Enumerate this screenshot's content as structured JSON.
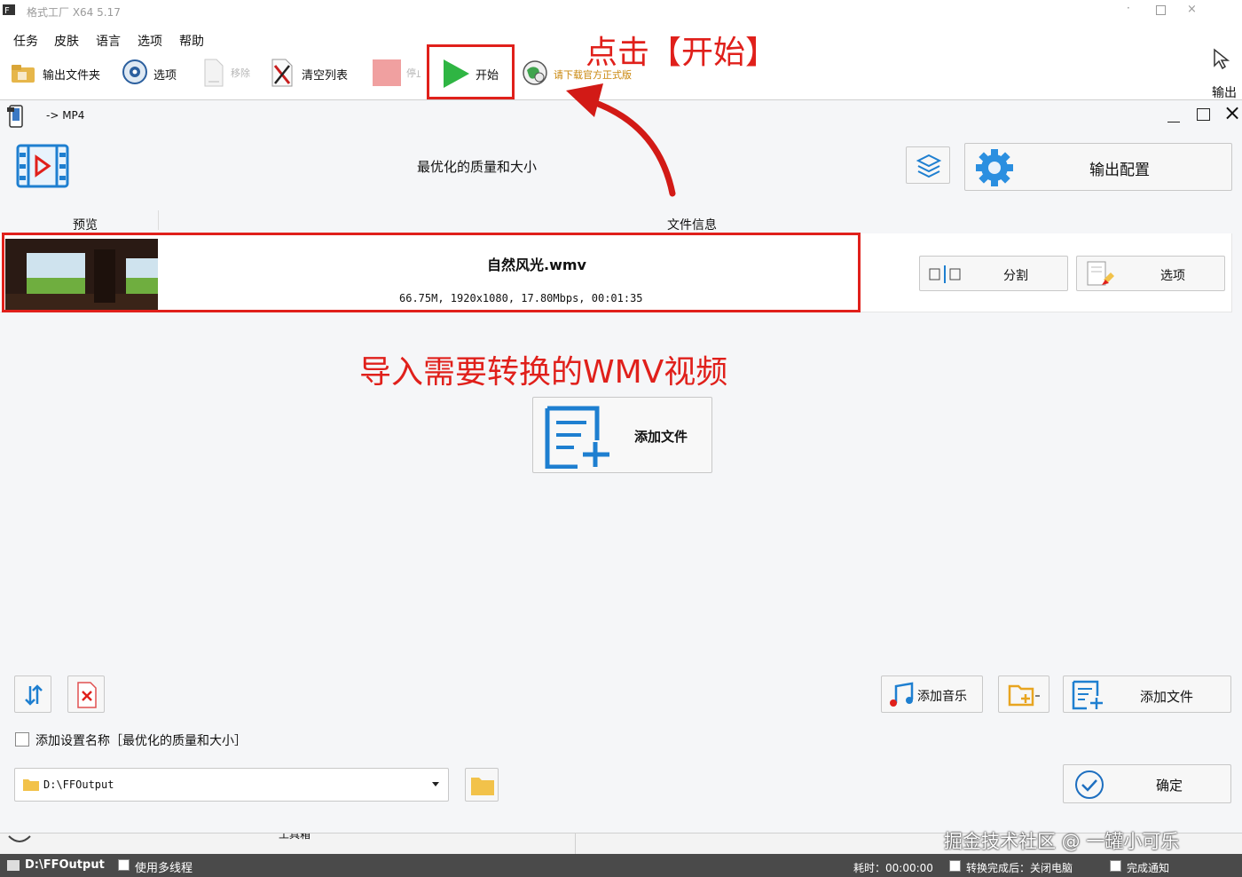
{
  "window": {
    "title": "格式工厂 X64 5.17",
    "menu": [
      "任务",
      "皮肤",
      "语言",
      "选项",
      "帮助"
    ],
    "toolbar": {
      "output_folder": "输出文件夹",
      "options": "选项",
      "remove": "移除",
      "clear_list": "清空列表",
      "stop": "停止",
      "start": "开始",
      "download": "请下载官方正式版",
      "side_label": "输出"
    }
  },
  "annotations": {
    "click_start": "点击【开始】",
    "import_wmv": "导入需要转换的WMV视频"
  },
  "dialog": {
    "format": "-> MP4",
    "profile": "最优化的质量和大小",
    "output_config": "输出配置",
    "col_preview": "预览",
    "col_fileinfo": "文件信息",
    "file": {
      "name": "自然风光.wmv",
      "meta": "66.75M, 1920x1080, 17.80Mbps, 00:01:35"
    },
    "split_label": "分割",
    "options_label": "选项",
    "add_file_center": "添加文件",
    "add_music": "添加音乐",
    "add_file": "添加文件",
    "add_setting_name": "添加设置名称［最优化的质量和大小］",
    "output_path": "D:\\FFOutput",
    "ok": "确定",
    "bottom_tab": "工具箱"
  },
  "statusbar": {
    "path": "D:\\FFOutput",
    "multithread": "使用多线程",
    "elapsed": "耗时：00:00:00",
    "after_convert": "转换完成后：关闭电脑",
    "notify": "完成通知"
  },
  "watermark": "掘金技术社区 @ 一罐小可乐",
  "colors": {
    "annotation_red": "#e0201b",
    "accent_blue": "#1e7fd0",
    "play_green": "#2fb543"
  }
}
